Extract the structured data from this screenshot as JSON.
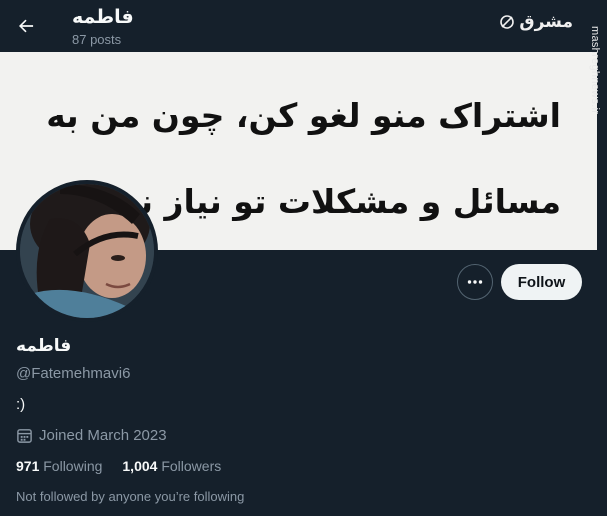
{
  "header": {
    "title": "فاطمه",
    "posts_count": "87 posts",
    "back_icon": "arrow-left-icon"
  },
  "watermark": {
    "logo_text": "مشرق",
    "site": "mashreghnews.ir"
  },
  "banner": {
    "line1": "اشتراک منو لغو کن، چون من به",
    "line2": "مسائل و مشکلات تو نیاز ندارم"
  },
  "profile": {
    "display_name": "فاطمه",
    "handle": "@Fatemehmavi6",
    "bio": ":)",
    "joined": "Joined March 2023",
    "following_count": "971",
    "following_label": "Following",
    "followers_count": "1,004",
    "followers_label": "Followers",
    "not_followed_text": "Not followed by anyone you’re following"
  },
  "actions": {
    "follow_label": "Follow",
    "more_icon": "more-dots-icon"
  },
  "colors": {
    "background": "#15202b",
    "text": "#f7f9f9",
    "secondary": "#8b98a5",
    "button_bg": "#eff3f4"
  }
}
